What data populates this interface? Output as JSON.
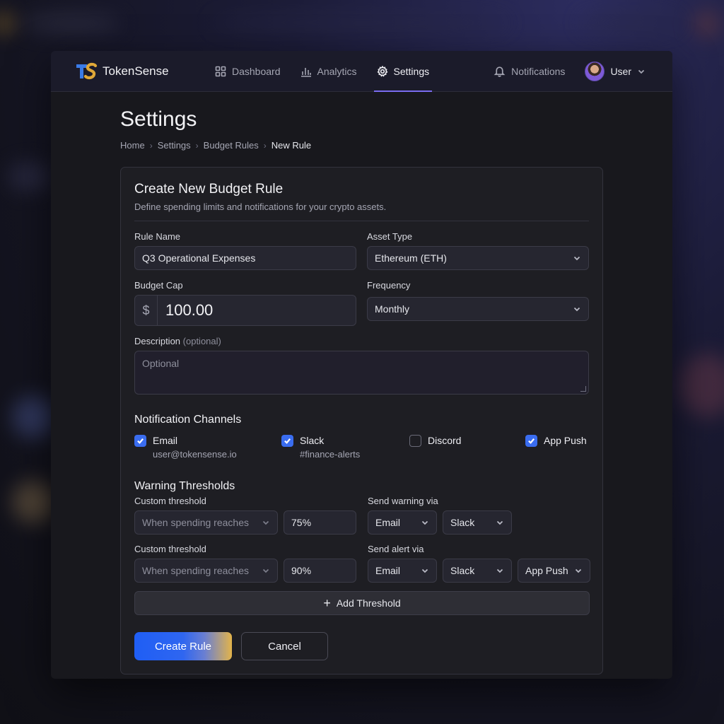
{
  "app": {
    "brand": "TokenSense"
  },
  "nav": {
    "items": [
      {
        "label": "Dashboard",
        "icon": "grid-icon"
      },
      {
        "label": "Analytics",
        "icon": "bar-chart-icon"
      },
      {
        "label": "Settings",
        "icon": "gear-icon",
        "active": true
      }
    ],
    "notifications_label": "Notifications",
    "user_label": "User"
  },
  "page": {
    "title": "Settings",
    "breadcrumb": [
      "Home",
      "Settings",
      "Budget Rules",
      "New Rule"
    ]
  },
  "form": {
    "title": "Create New Budget Rule",
    "subtitle": "Define spending limits and notifications for your crypto assets.",
    "rule_name": {
      "label": "Rule Name",
      "value": "Q3 Operational Expenses"
    },
    "asset_type": {
      "label": "Asset Type",
      "value": "Ethereum (ETH)"
    },
    "budget_cap": {
      "label": "Budget Cap",
      "currency": "$",
      "value": "100.00"
    },
    "frequency": {
      "label": "Frequency",
      "value": "Monthly"
    },
    "description": {
      "label": "Description",
      "optional_note": "(optional)",
      "placeholder": "Optional"
    },
    "channels_title": "Notification Channels",
    "channels": [
      {
        "name": "Email",
        "detail": "user@tokensense.io",
        "checked": true
      },
      {
        "name": "Slack",
        "detail": "#finance-alerts",
        "checked": true
      },
      {
        "name": "Discord",
        "detail": "",
        "checked": false
      },
      {
        "name": "App Push",
        "detail": "",
        "checked": true
      }
    ],
    "thresholds_title": "Warning Thresholds",
    "thresholds": [
      {
        "label": "Custom threshold",
        "condition": "When spending reaches",
        "percent": "75%",
        "via_label": "Send warning via",
        "via": [
          "Email",
          "Slack"
        ]
      },
      {
        "label": "Custom threshold",
        "condition": "When spending reaches",
        "percent": "90%",
        "via_label": "Send alert via",
        "via": [
          "Email",
          "Slack",
          "App Push"
        ]
      }
    ],
    "add_threshold_label": "Add Threshold",
    "create_label": "Create Rule",
    "cancel_label": "Cancel"
  },
  "colors": {
    "accent": "#3a6df0",
    "nav_underline": "#7a6cf0",
    "gold": "#e3b44a"
  }
}
